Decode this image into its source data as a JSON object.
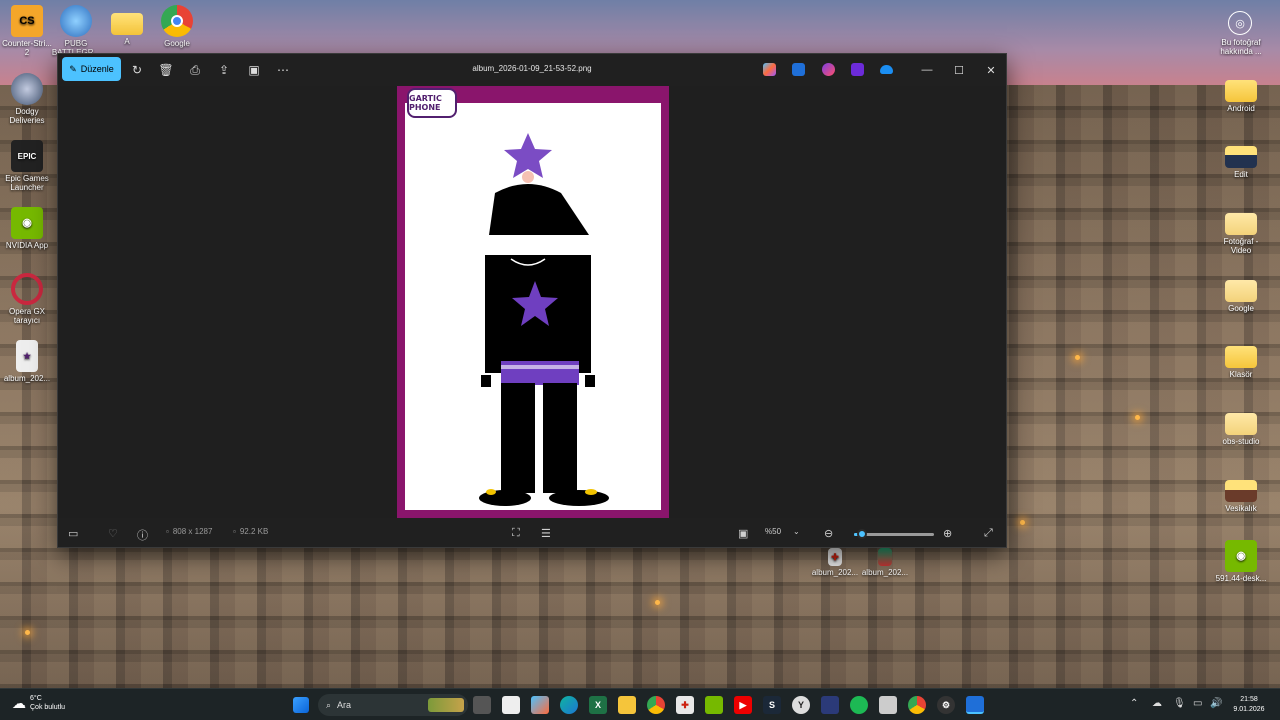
{
  "window": {
    "title": "album_2026-01-09_21-53-52.png",
    "edit_label": "Düzenle",
    "status": {
      "dimensions": "808 x 1287",
      "size": "92.2 KB",
      "zoom": "%50",
      "zoom_level_fraction": 0.1
    },
    "photo_logo_text": "GARTIC PHONE"
  },
  "desktop_left": [
    {
      "label": "Counter-Stri... 2",
      "icon": "cs2-icon",
      "color": "#f4a62a"
    },
    {
      "label": "PUBG BATTLEGR...",
      "icon": "pubg-globe-icon",
      "color": "#3b7fd1"
    },
    {
      "label": "A",
      "icon": "folder-icon",
      "color": "#f5c53b"
    },
    {
      "label": "Google",
      "icon": "chrome-icon",
      "color": "#e84335"
    },
    {
      "label": "Dodgy Deliveries",
      "icon": "dodgy-icon",
      "color": "#586a8b"
    },
    {
      "label": "Epic Games Launcher",
      "icon": "epic-icon",
      "color": "#222"
    },
    {
      "label": "NVIDIA App",
      "icon": "nvidia-icon",
      "color": "#76b900"
    },
    {
      "label": "Opera GX tarayıcı",
      "icon": "opera-icon",
      "color": "#c9283f"
    },
    {
      "label": "album_202...",
      "icon": "image-file-icon",
      "color": "#eee"
    }
  ],
  "desktop_right": [
    {
      "label": "Bu fotoğraf hakkında ...",
      "icon": "camera-icon"
    },
    {
      "label": "Android",
      "icon": "folder-icon"
    },
    {
      "label": "Edit",
      "icon": "folder-icon"
    },
    {
      "label": "Fotoğraf - Video",
      "icon": "folder-icon"
    },
    {
      "label": "Google",
      "icon": "folder-icon"
    },
    {
      "label": "Klasör",
      "icon": "folder-icon"
    },
    {
      "label": "obs-studio",
      "icon": "folder-icon"
    },
    {
      "label": "Vesikalık",
      "icon": "folder-icon"
    },
    {
      "label": "591.44-desk...",
      "icon": "nvidia-icon"
    }
  ],
  "desktop_bottom_files": [
    "album_202...",
    "album_202..."
  ],
  "taskbar": {
    "search_placeholder": "Ara",
    "weather_temp": "6°C",
    "weather_text": "Çok bulutlu",
    "time": "21:58",
    "date": "9.01.2026"
  },
  "colors": {
    "accent": "#4cc2ff",
    "photo_border": "#8a156c",
    "window_bg": "#202020",
    "taskbar_bg": "#1d2426"
  }
}
